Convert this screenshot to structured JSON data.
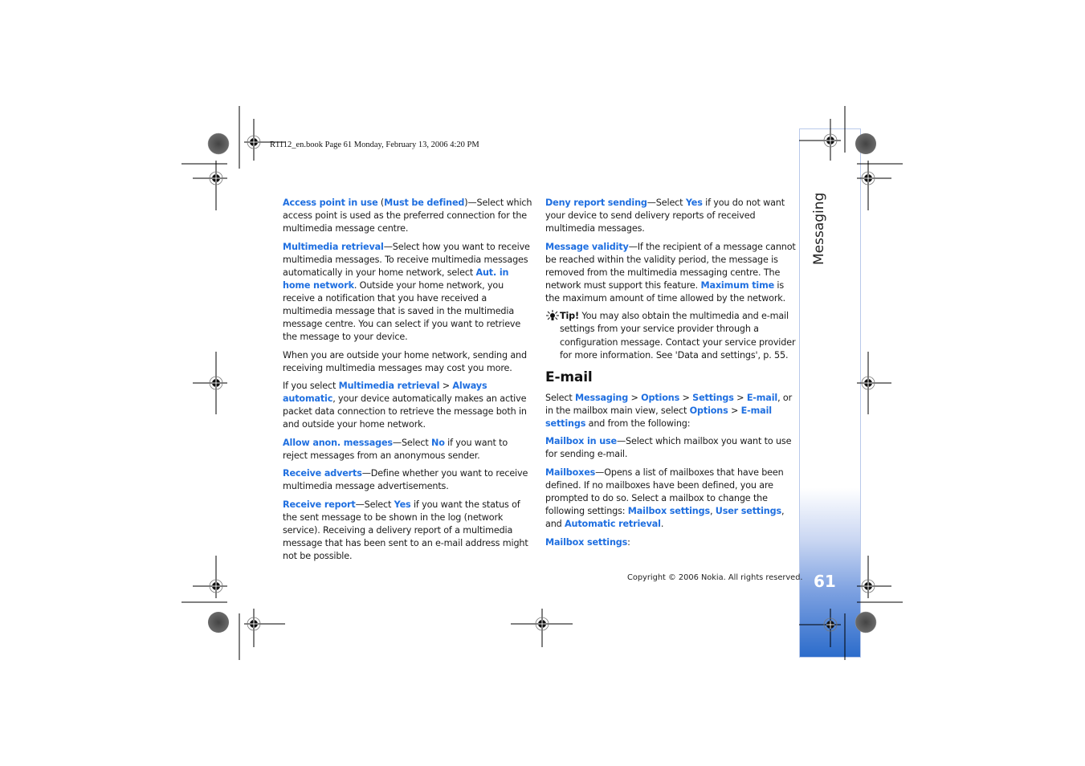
{
  "header": {
    "print_info": "R1112_en.book  Page 61  Monday, February 13, 2006  4:20 PM"
  },
  "side_tab": {
    "label": "Messaging",
    "page_number": "61",
    "colors": {
      "gradient_end": "#2c6ccb",
      "border": "#b9c9ea"
    }
  },
  "accent_color": "#1f6fe0",
  "left_column": {
    "p1": {
      "k1": "Access point in use",
      "t1": " (",
      "k2": "Must be defined",
      "t2": ")—Select which access point is used as the preferred connection for the multimedia message centre."
    },
    "p2": {
      "k1": "Multimedia retrieval",
      "t1": "—Select how you want to receive multimedia messages. To receive multimedia messages automatically in your home network, select ",
      "k2": "Aut. in home network",
      "t2": ". Outside your home network, you receive a notification that you have received a multimedia message that is saved in the multimedia message centre. You can select if you want to retrieve the message to your device."
    },
    "p3": {
      "t1": "When you are outside your home network, sending and receiving multimedia messages may cost you more."
    },
    "p4": {
      "t1": "If you select ",
      "k1": "Multimedia retrieval",
      "t2": " > ",
      "k2": "Always automatic",
      "t3": ", your device automatically makes an active packet data connection to retrieve the message both in and outside your home network."
    },
    "p5": {
      "k1": "Allow anon. messages",
      "t1": "—Select ",
      "k2": "No",
      "t2": " if you want to reject messages from an anonymous sender."
    },
    "p6": {
      "k1": "Receive adverts",
      "t1": "—Define whether you want to receive multimedia message advertisements."
    },
    "p7": {
      "k1": "Receive report",
      "t1": "—Select ",
      "k2": "Yes",
      "t2": " if you want the status of the sent message to be shown in the log (network service). Receiving a delivery report of a multimedia message that has been sent to an e-mail address might not be possible."
    }
  },
  "right_column": {
    "p1": {
      "k1": "Deny report sending",
      "t1": "—Select ",
      "k2": "Yes",
      "t2": " if you do not want your device to send delivery reports of received multimedia messages."
    },
    "p2": {
      "k1": "Message validity",
      "t1": "—If the recipient of a message cannot be reached within the validity period, the message is removed from the multimedia messaging centre. The network must support this feature. ",
      "k2": "Maximum time",
      "t2": " is the maximum amount of time allowed by the network."
    },
    "tip": {
      "icon": "lightbulb-icon",
      "label": "Tip!",
      "text": " You may also obtain the multimedia and e-mail settings from your service provider through a configuration message. Contact your service provider for more information. See 'Data and settings', p. 55."
    },
    "heading": "E-mail",
    "p3": {
      "t1": "Select ",
      "k1": "Messaging",
      "t2": " > ",
      "k2": "Options",
      "t3": " > ",
      "k3": "Settings",
      "t4": " > ",
      "k4": "E-mail",
      "t5": ", or in the mailbox main view, select ",
      "k5": "Options",
      "t6": " > ",
      "k6": "E-mail settings",
      "t7": " and from the following:"
    },
    "p4": {
      "k1": "Mailbox in use",
      "t1": "—Select which mailbox you want to use for sending e-mail."
    },
    "p5": {
      "k1": "Mailboxes",
      "t1": "—Opens a list of mailboxes that have been defined. If no mailboxes have been defined, you are prompted to do so. Select a mailbox to change the following settings: ",
      "k2": "Mailbox settings",
      "t2": ", ",
      "k3": "User settings",
      "t3": ", and ",
      "k4": "Automatic retrieval",
      "t4": "."
    },
    "p6": {
      "k1": "Mailbox settings",
      "t1": ":"
    }
  },
  "footer": {
    "copyright": "Copyright © 2006 Nokia. All rights reserved."
  }
}
